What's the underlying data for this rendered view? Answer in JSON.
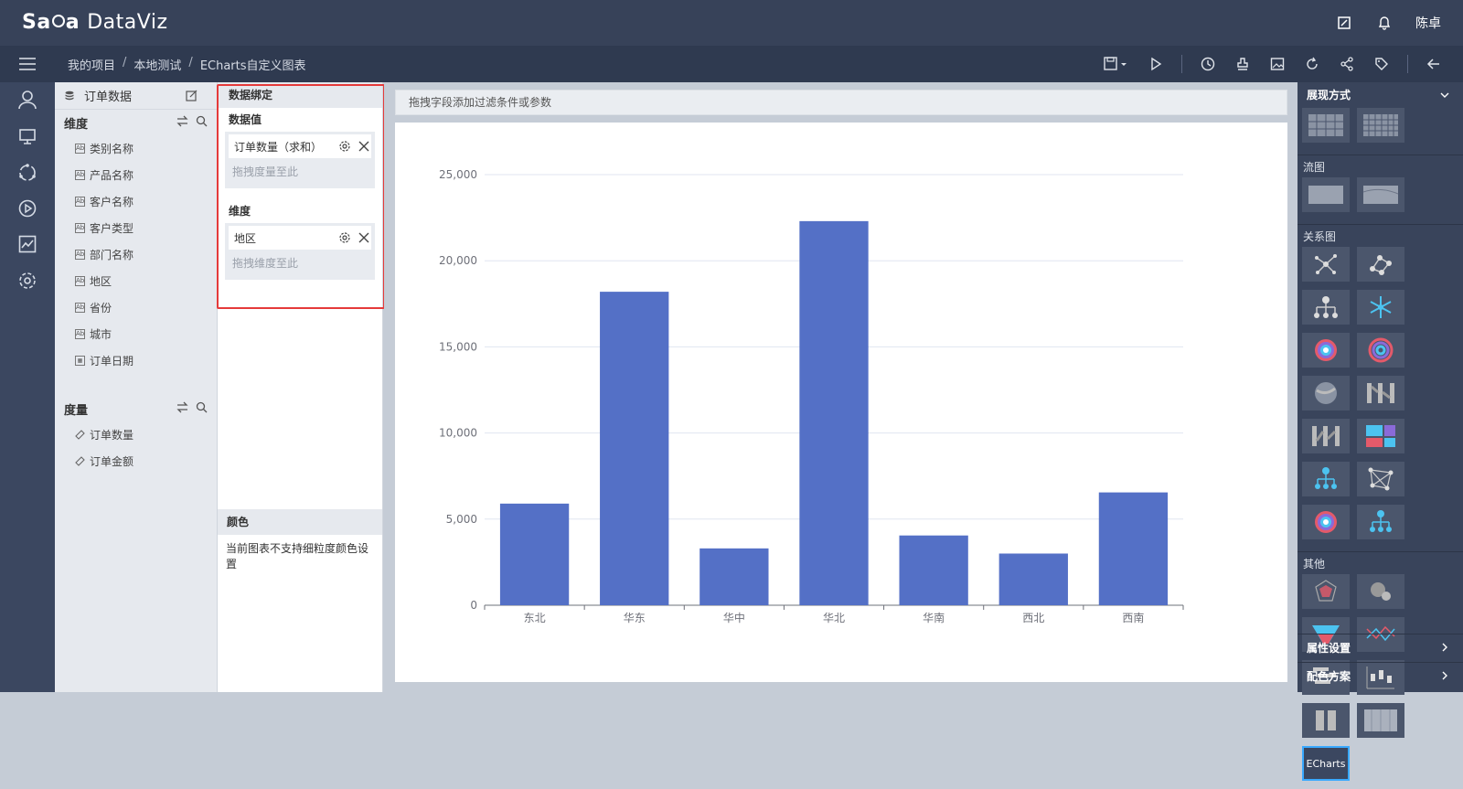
{
  "app": {
    "logo_a": "Sa",
    "logo_b": "a",
    "logo_c": "DataViz",
    "user": "陈卓"
  },
  "breadcrumb": [
    "我的项目",
    "本地测试",
    "ECharts自定义图表"
  ],
  "fields_panel": {
    "datasource": "订单数据",
    "dimension_title": "维度",
    "dimensions": [
      "类别名称",
      "产品名称",
      "客户名称",
      "客户类型",
      "部门名称",
      "地区",
      "省份",
      "城市",
      "订单日期"
    ],
    "measure_title": "度量",
    "measures": [
      "订单数量",
      "订单金额"
    ]
  },
  "binding": {
    "title": "数据绑定",
    "value_label": "数据值",
    "value_chip": "订单数量（求和）",
    "value_drop": "拖拽度量至此",
    "dim_label": "维度",
    "dim_chip": "地区",
    "dim_drop": "拖拽维度至此",
    "color_title": "颜色",
    "color_text": "当前图表不支持细粒度颜色设置"
  },
  "filter_placeholder": "拖拽字段添加过滤条件或参数",
  "chart_data": {
    "type": "bar",
    "categories": [
      "东北",
      "华东",
      "华中",
      "华北",
      "华南",
      "西北",
      "西南"
    ],
    "values": [
      5900,
      18200,
      3300,
      22300,
      4050,
      3000,
      6550
    ],
    "ylim": [
      0,
      25000
    ],
    "yticks": [
      0,
      5000,
      10000,
      15000,
      20000,
      25000
    ],
    "ytick_labels": [
      "0",
      "5,000",
      "10,000",
      "15,000",
      "20,000",
      "25,000"
    ],
    "bar_color": "#5470c6",
    "grid": true
  },
  "right_panel": {
    "display_title": "展现方式",
    "flow_title": "流图",
    "relation_title": "关系图",
    "other_title": "其他",
    "echarts_label": "ECharts",
    "attr_title": "属性设置",
    "palette_title": "配色方案"
  }
}
